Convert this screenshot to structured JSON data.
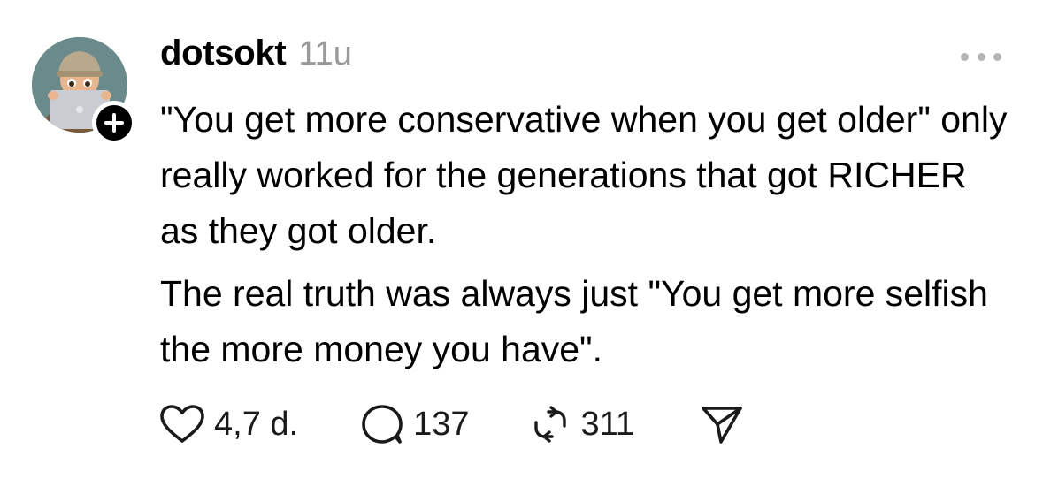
{
  "post": {
    "username": "dotsokt",
    "timestamp": "11u",
    "paragraphs": [
      "\"You get more conservative when you get older\" only really worked for the generations that got RICHER as they got older.",
      "The real truth was always just \"You get more selfish the more money you have\"."
    ]
  },
  "actions": {
    "likes": "4,7 d.",
    "replies": "137",
    "reposts": "311"
  },
  "icons": {
    "avatar": "avatar-image",
    "follow": "plus-icon",
    "more": "more-dots-icon",
    "like": "heart-icon",
    "reply": "speech-bubble-icon",
    "repost": "repost-icon",
    "share": "send-icon"
  },
  "colors": {
    "text": "#000000",
    "muted": "#999999",
    "icon": "#1a1a1a"
  }
}
